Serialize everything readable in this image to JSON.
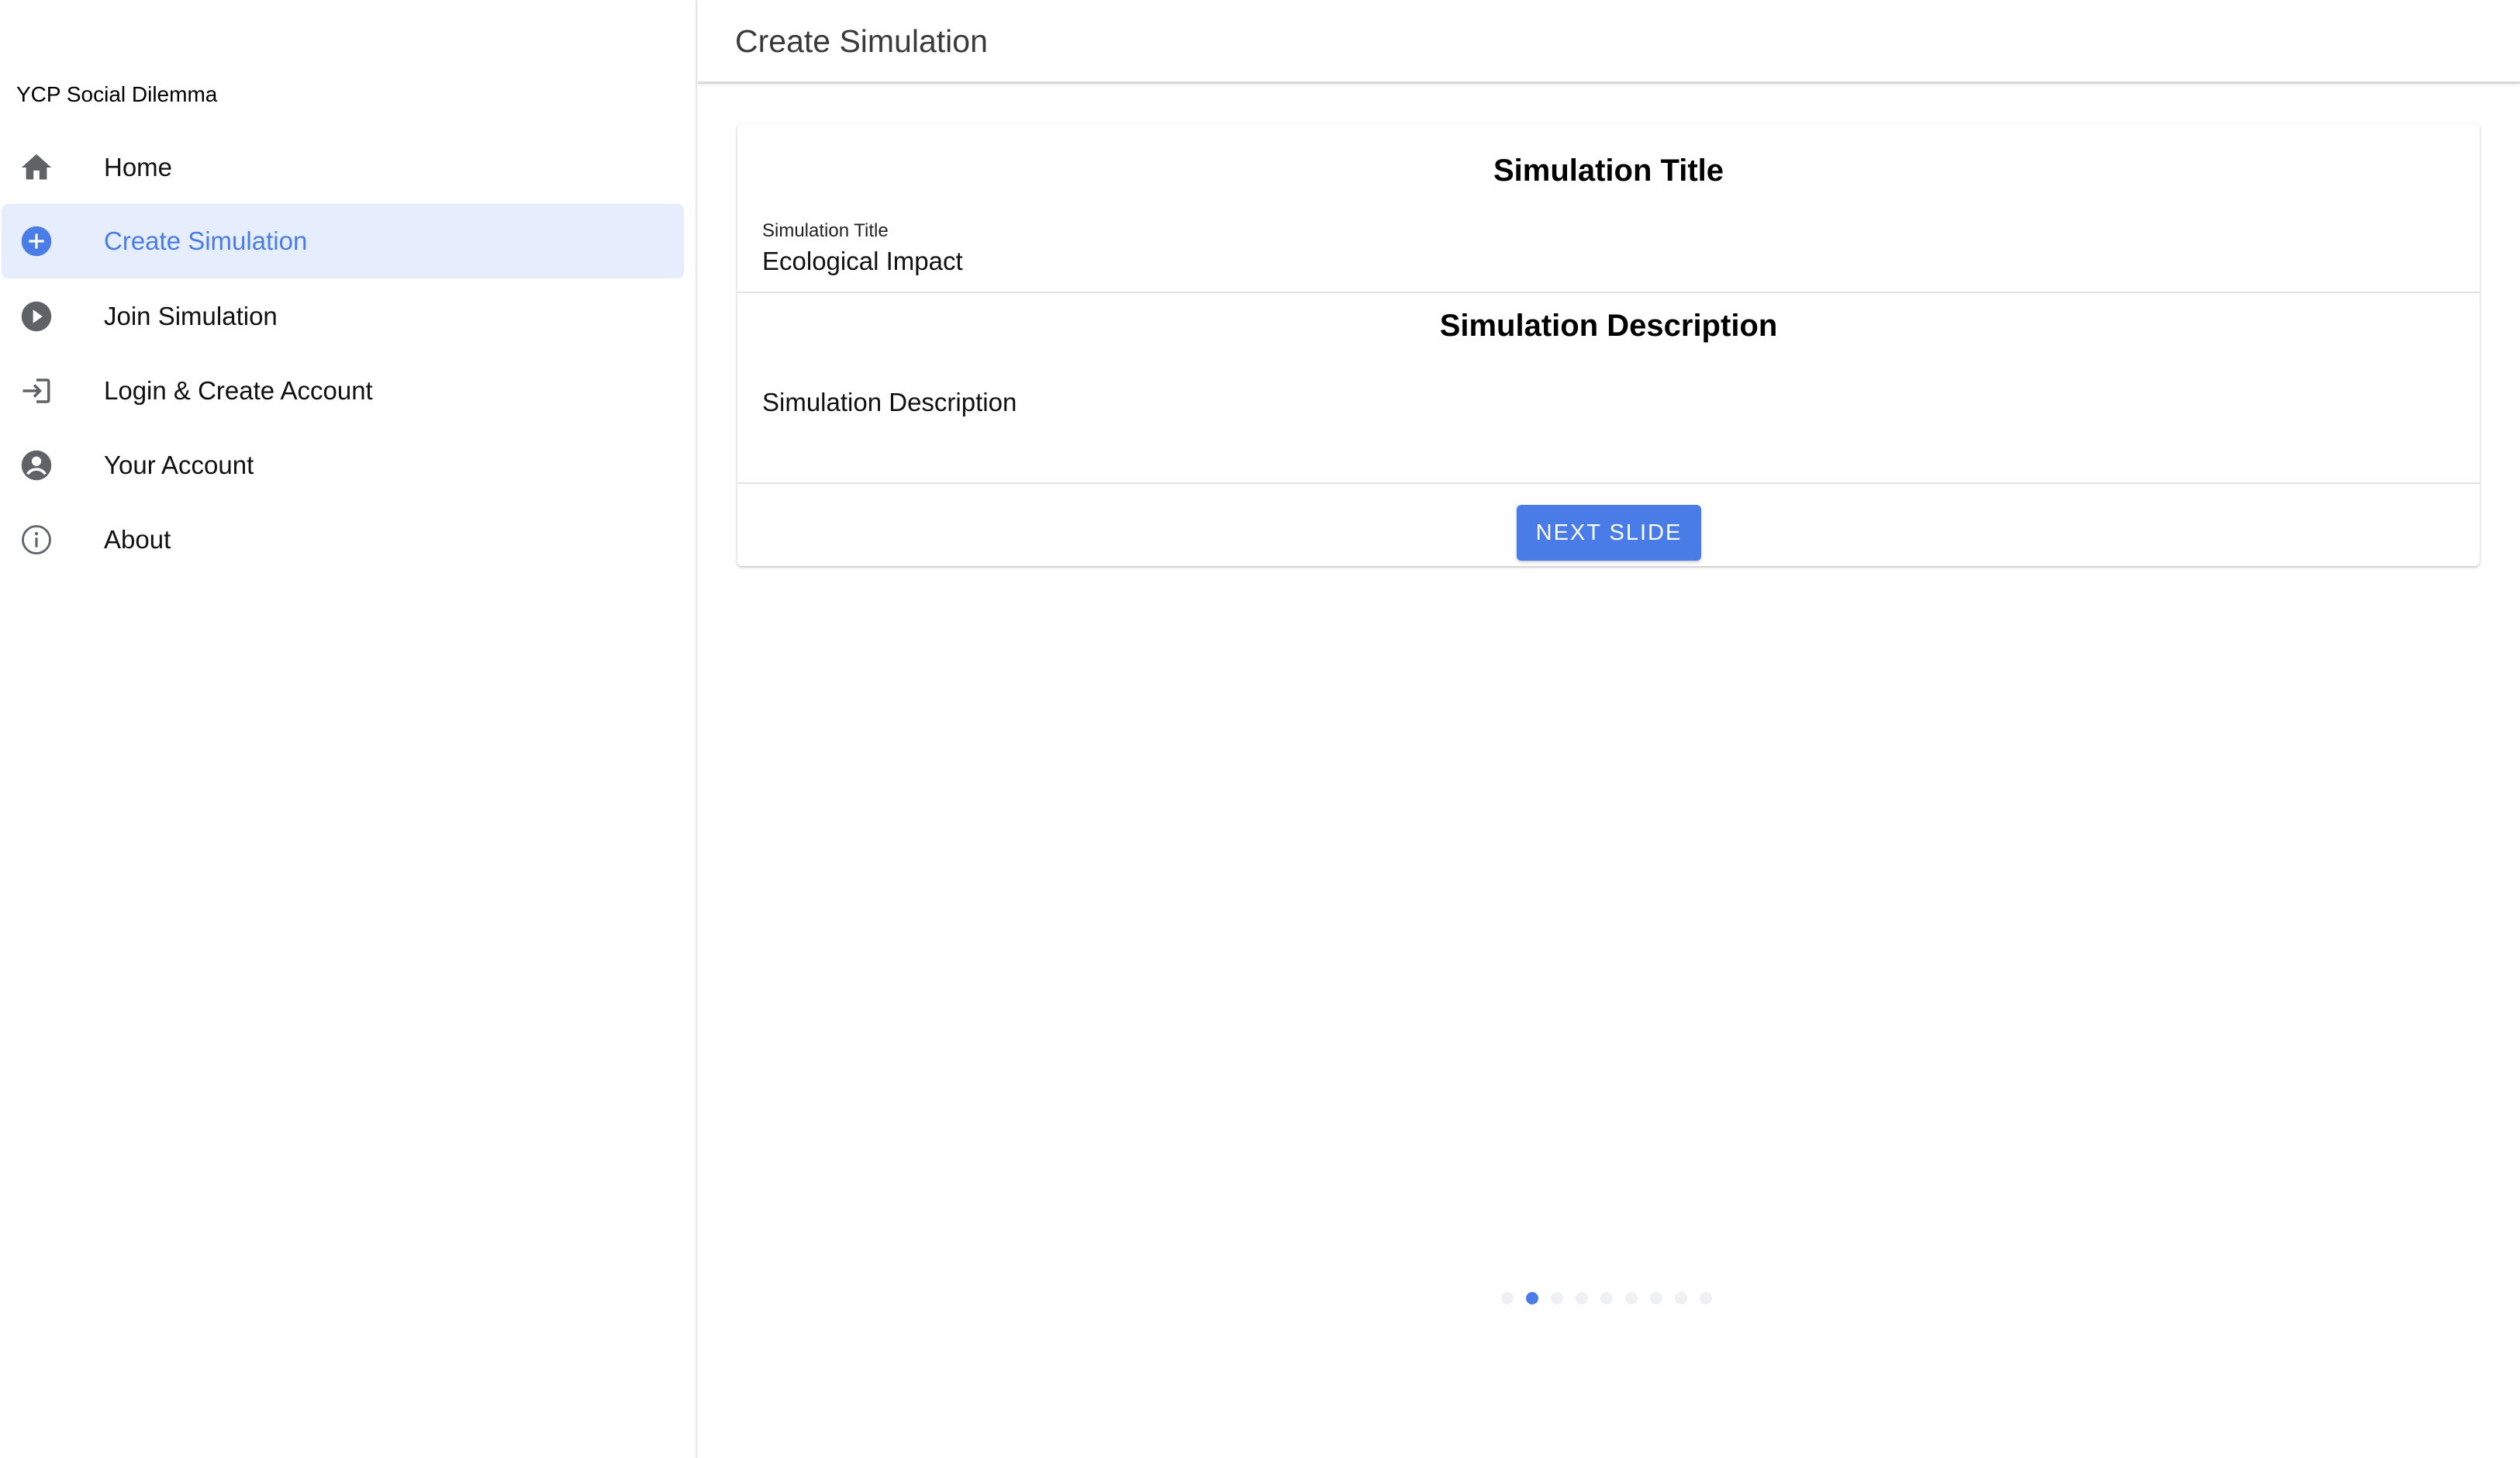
{
  "app": {
    "name": "YCP Social Dilemma"
  },
  "sidebar": {
    "items": [
      {
        "label": "Home",
        "icon": "home-icon",
        "active": false
      },
      {
        "label": "Create Simulation",
        "icon": "add-circle-icon",
        "active": true
      },
      {
        "label": "Join Simulation",
        "icon": "play-circle-icon",
        "active": false
      },
      {
        "label": "Login & Create Account",
        "icon": "login-icon",
        "active": false
      },
      {
        "label": "Your Account",
        "icon": "account-circle-icon",
        "active": false
      },
      {
        "label": "About",
        "icon": "info-icon",
        "active": false
      }
    ]
  },
  "header": {
    "title": "Create Simulation"
  },
  "main": {
    "title_section": {
      "heading": "Simulation Title",
      "field_label": "Simulation Title",
      "field_value": "Ecological Impact"
    },
    "description_section": {
      "heading": "Simulation Description",
      "placeholder": "Simulation Description"
    },
    "next_button": "NEXT SLIDE"
  },
  "pager": {
    "total": 9,
    "current": 2
  },
  "colors": {
    "accent": "#4a7ce8",
    "active_bg": "#e6edfc",
    "icon": "#5f6368"
  }
}
